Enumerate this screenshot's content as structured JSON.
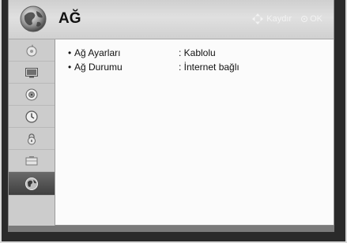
{
  "header": {
    "title": "AĞ",
    "hint_move": "Kaydır",
    "hint_ok": "OK"
  },
  "sidebar": {
    "items": [
      {
        "icon": "picture-icon"
      },
      {
        "icon": "screen-icon"
      },
      {
        "icon": "audio-icon"
      },
      {
        "icon": "clock-icon"
      },
      {
        "icon": "lock-icon"
      },
      {
        "icon": "options-icon"
      },
      {
        "icon": "network-globe-icon",
        "active": true
      }
    ]
  },
  "settings": [
    {
      "bullet": "•",
      "label": "Ağ Ayarları",
      "value": ": Kablolu"
    },
    {
      "bullet": "•",
      "label": "Ağ Durumu",
      "value": ": İnternet bağlı"
    }
  ],
  "colors": {
    "active_item": "#4f4f4f",
    "panel": "#fbfbfb",
    "sidebar": "#cccccc"
  }
}
